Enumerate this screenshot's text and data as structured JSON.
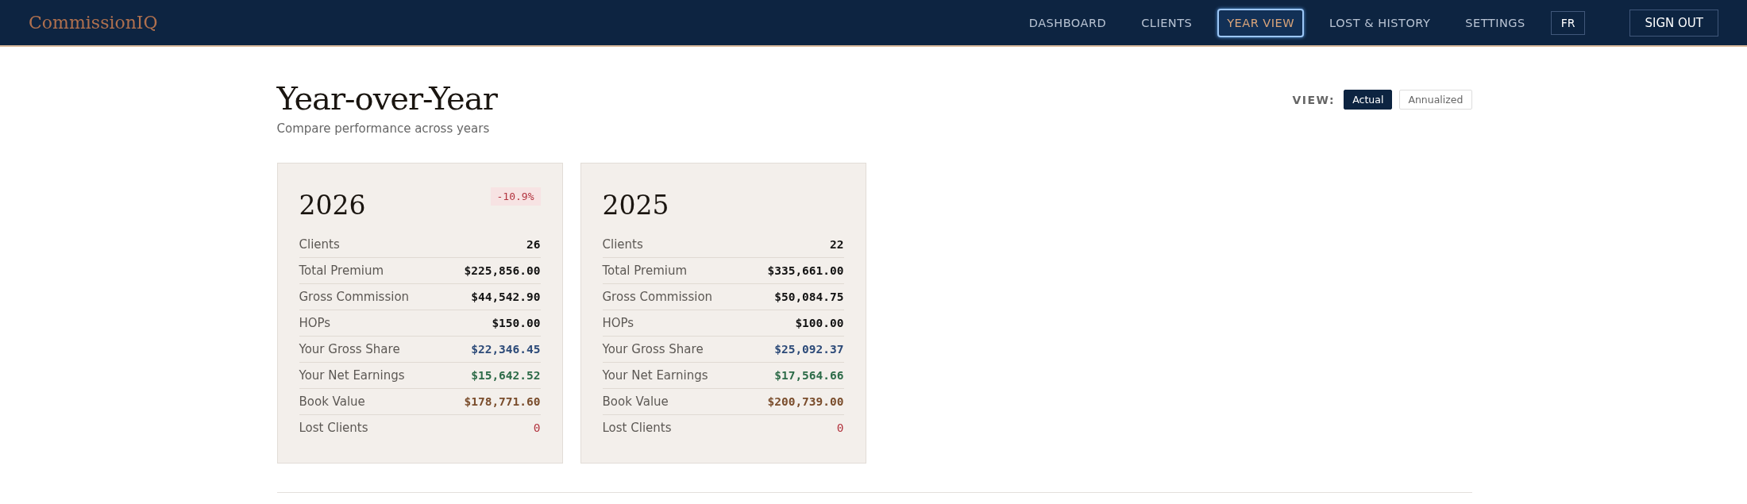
{
  "brand": "CommissionIQ",
  "nav": [
    {
      "label": "DASHBOARD",
      "selected": false
    },
    {
      "label": "CLIENTS",
      "selected": false
    },
    {
      "label": "YEAR VIEW",
      "selected": true
    },
    {
      "label": "LOST & HISTORY",
      "selected": false
    },
    {
      "label": "SETTINGS",
      "selected": false
    }
  ],
  "language_button": "FR",
  "sign_out": "SIGN OUT",
  "page": {
    "title": "Year-over-Year",
    "subtitle": "Compare performance across years"
  },
  "view_toggle": {
    "label": "VIEW:",
    "options": [
      {
        "label": "Actual",
        "selected": true
      },
      {
        "label": "Annualized",
        "selected": false
      }
    ]
  },
  "cards": [
    {
      "year": "2026",
      "change": {
        "text": "-10.9%",
        "kind": "negative"
      },
      "rows": [
        {
          "label": "Clients",
          "value": "26",
          "kind": "plain"
        },
        {
          "label": "Total Premium",
          "value": "$225,856.00",
          "kind": "plain"
        },
        {
          "label": "Gross Commission",
          "value": "$44,542.90",
          "kind": "plain"
        },
        {
          "label": "HOPs",
          "value": "$150.00",
          "kind": "plain"
        },
        {
          "label": "Your Gross Share",
          "value": "$22,346.45",
          "kind": "share"
        },
        {
          "label": "Your Net Earnings",
          "value": "$15,642.52",
          "kind": "net"
        },
        {
          "label": "Book Value",
          "value": "$178,771.60",
          "kind": "book"
        },
        {
          "label": "Lost Clients",
          "value": "0",
          "kind": "lost"
        }
      ]
    },
    {
      "year": "2025",
      "rows": [
        {
          "label": "Clients",
          "value": "22",
          "kind": "plain"
        },
        {
          "label": "Total Premium",
          "value": "$335,661.00",
          "kind": "plain"
        },
        {
          "label": "Gross Commission",
          "value": "$50,084.75",
          "kind": "plain"
        },
        {
          "label": "HOPs",
          "value": "$100.00",
          "kind": "plain"
        },
        {
          "label": "Your Gross Share",
          "value": "$25,092.37",
          "kind": "share"
        },
        {
          "label": "Your Net Earnings",
          "value": "$17,564.66",
          "kind": "net"
        },
        {
          "label": "Book Value",
          "value": "$200,739.00",
          "kind": "book"
        },
        {
          "label": "Lost Clients",
          "value": "0",
          "kind": "lost"
        }
      ]
    }
  ]
}
